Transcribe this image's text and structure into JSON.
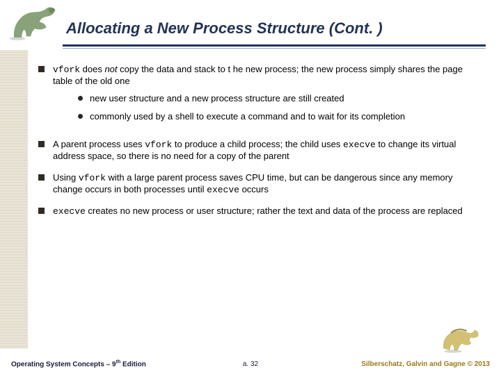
{
  "header": {
    "title": "Allocating a New Process Structure (Cont. )"
  },
  "bullets": {
    "b1_a": "vfork",
    "b1_b": " does ",
    "b1_c": "not",
    "b1_d": " copy the data and stack to t he new process; the new process simply shares the page table of the old one",
    "b1_sub1": "new user structure and a new process structure are still created",
    "b1_sub2": "commonly used by a shell to execute a command and to wait for its completion",
    "b2_a": "A parent process uses ",
    "b2_b": "vfork",
    "b2_c": " to produce a child process; the child uses ",
    "b2_d": "execve",
    "b2_e": " to change its virtual address space, so there is no need for a copy of the parent",
    "b3_a": "Using ",
    "b3_b": "vfork",
    "b3_c": " with a large parent process saves CPU time, but can be dangerous since any memory change occurs in both processes until ",
    "b3_d": "execve",
    "b3_e": " occurs",
    "b4_a": "execve",
    "b4_b": " creates no new process or user structure; rather the text and data of the process are replaced"
  },
  "footer": {
    "left_a": "Operating System Concepts – 9",
    "left_b": "th",
    "left_c": " Edition",
    "center": "a. 32",
    "right": "Silberschatz, Galvin and Gagne © 2013"
  }
}
